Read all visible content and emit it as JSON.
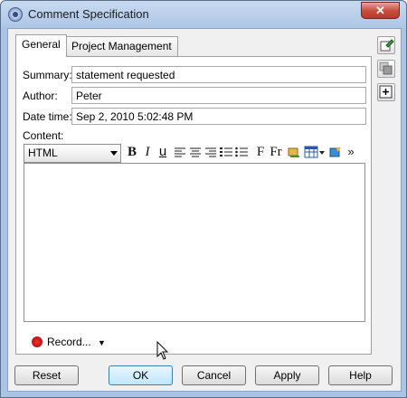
{
  "window": {
    "title": "Comment Specification",
    "close_glyph": "✕"
  },
  "tabs": [
    {
      "label": "General",
      "active": true
    },
    {
      "label": "Project Management",
      "active": false
    }
  ],
  "form": {
    "summary_label": "Summary:",
    "summary_value": "statement requested",
    "author_label": "Author:",
    "author_value": "Peter",
    "datetime_label": "Date time:",
    "datetime_value": "Sep 2, 2010 5:02:48 PM",
    "content_label": "Content:"
  },
  "toolbar": {
    "format_value": "HTML",
    "bold": "B",
    "italic": "I",
    "underline": "u",
    "font": "F",
    "font_size": "Fr",
    "more": "»"
  },
  "record": {
    "label": "Record..."
  },
  "buttons": {
    "reset": "Reset",
    "ok": "OK",
    "cancel": "Cancel",
    "apply": "Apply",
    "help": "Help"
  },
  "colors": {
    "accent": "#3c7fb1",
    "record": "#cc0000"
  }
}
